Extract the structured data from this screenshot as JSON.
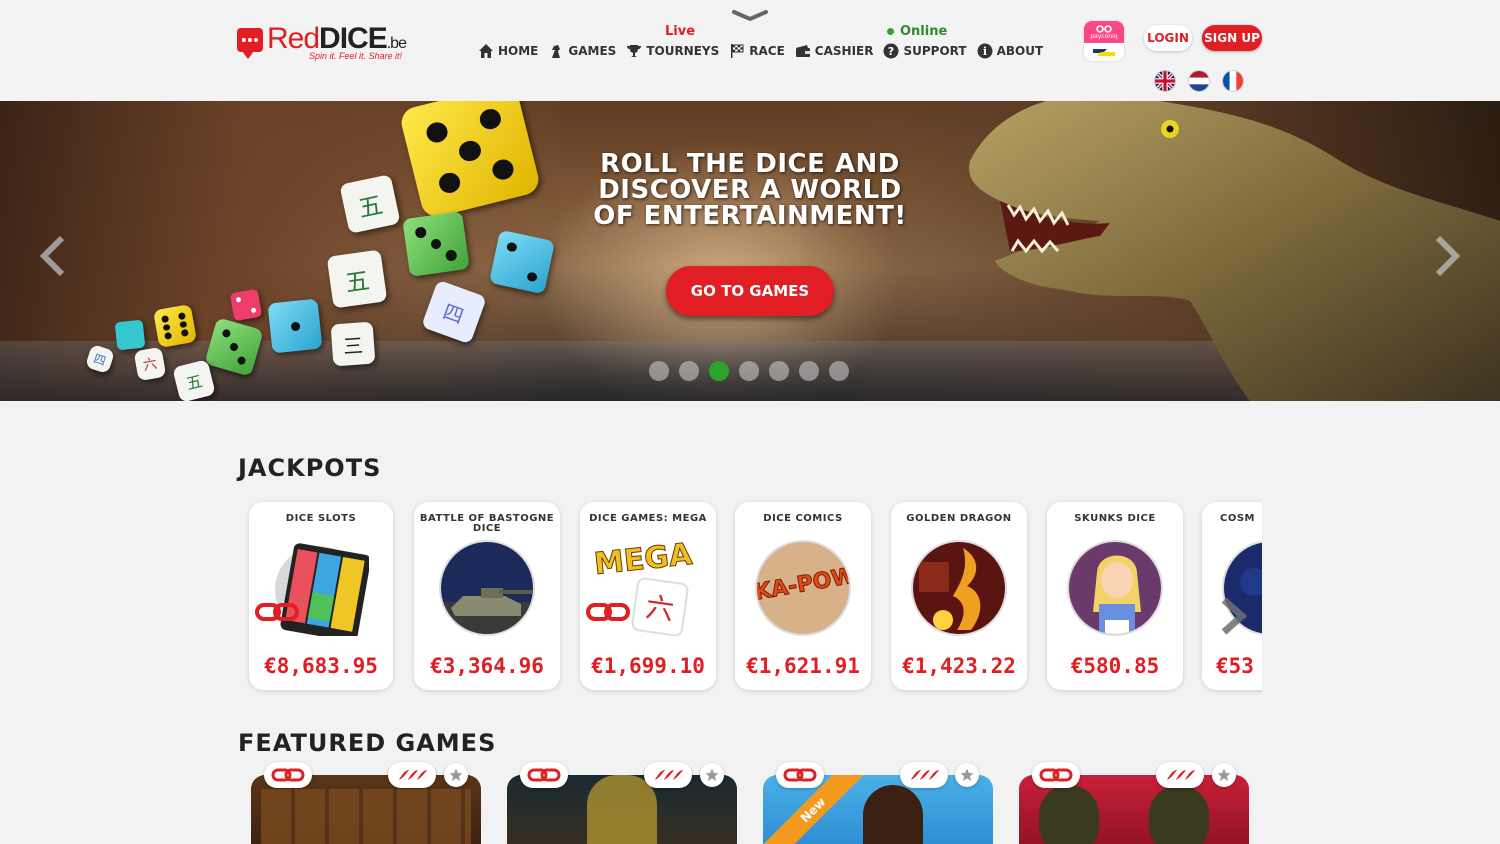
{
  "brand": {
    "name_part1": "Red",
    "name_part2": "DICE",
    "tld": ".be",
    "tagline": "Spin it. Feel it. Share it!",
    "color": "#e01e24"
  },
  "header": {
    "live_label": "Live",
    "online_label": "Online",
    "nav": [
      {
        "label": "HOME",
        "icon": "home-icon"
      },
      {
        "label": "GAMES",
        "icon": "chess-knight-icon"
      },
      {
        "label": "TOURNEYS",
        "icon": "trophy-icon"
      },
      {
        "label": "RACE",
        "icon": "checkered-flag-icon"
      },
      {
        "label": "CASHIER",
        "icon": "wallet-icon"
      },
      {
        "label": "SUPPORT",
        "icon": "question-icon"
      },
      {
        "label": "ABOUT",
        "icon": "info-icon"
      }
    ],
    "payconiq_label": "payconiq",
    "login_label": "LOGIN",
    "signup_label": "SIGN UP",
    "languages": [
      "English",
      "Nederlands",
      "Français"
    ]
  },
  "hero": {
    "headline": "ROLL THE DICE AND DISCOVER A WORLD OF ENTERTAINMENT!",
    "cta_label": "GO TO GAMES",
    "slide_count": 7,
    "active_slide": 3
  },
  "jackpots": {
    "title": "JACKPOTS",
    "items": [
      {
        "name": "DICE SLOTS",
        "amount": "€8,683.95",
        "linked": true
      },
      {
        "name": "BATTLE OF BASTOGNE DICE",
        "amount": "€3,364.96",
        "linked": false
      },
      {
        "name": "DICE GAMES: MEGA",
        "amount": "€1,699.10",
        "linked": true
      },
      {
        "name": "DICE COMICS",
        "amount": "€1,621.91",
        "linked": false
      },
      {
        "name": "GOLDEN DRAGON",
        "amount": "€1,423.22",
        "linked": false
      },
      {
        "name": "SKUNKS DICE",
        "amount": "€580.85",
        "linked": false
      },
      {
        "name": "COSM",
        "amount": "€53",
        "linked": false
      }
    ],
    "mega_label": "MEGA",
    "kapow_label": "KA-POW"
  },
  "featured": {
    "title": "FEATURED GAMES",
    "new_label": "New"
  }
}
